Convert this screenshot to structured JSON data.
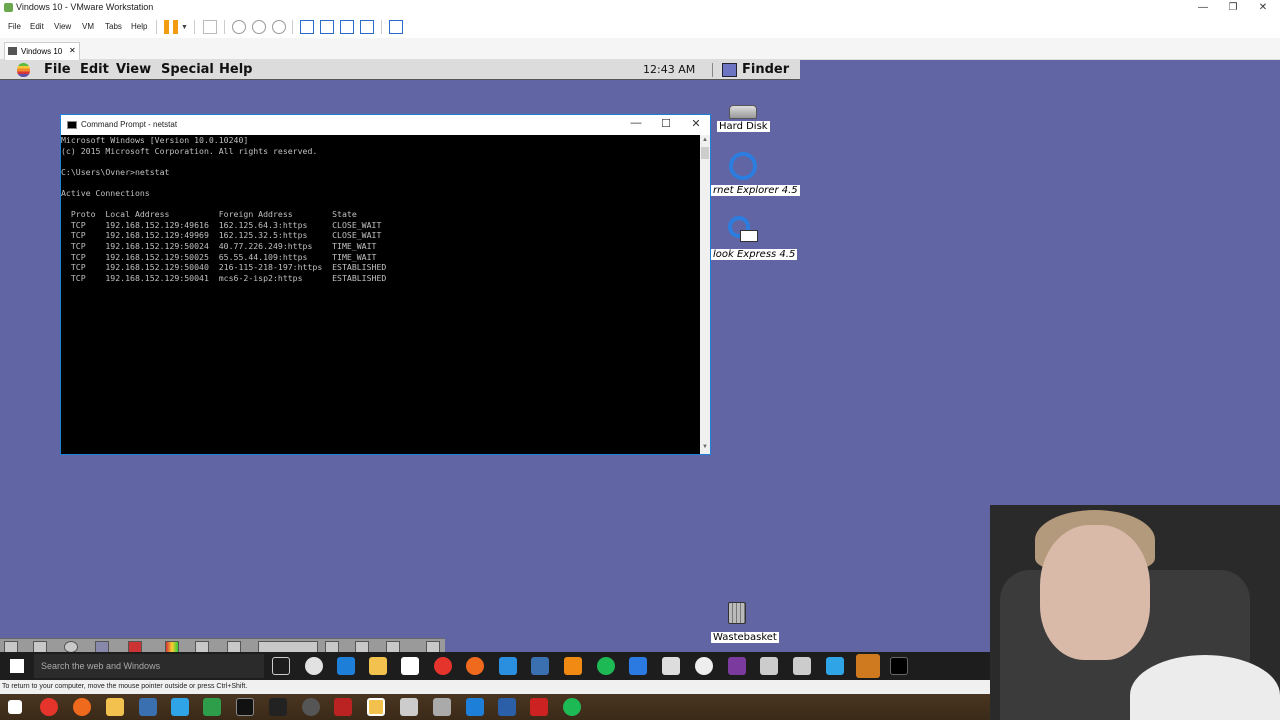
{
  "host": {
    "title": "Vindows 10 - VMware Workstation",
    "menu": [
      "File",
      "Edit",
      "View",
      "VM",
      "Tabs",
      "Help"
    ],
    "tab_label": "Vindows 10",
    "status_text": "To return to your computer, move the mouse pointer outside or press Ctrl+Shift."
  },
  "mac_menubar": {
    "items": [
      "File",
      "Edit",
      "View",
      "Special",
      "Help"
    ],
    "clock": "12:43 AM",
    "finder": "Finder"
  },
  "cmd": {
    "title": "Command Prompt - netstat",
    "output": "Microsoft Windows [Version 10.0.10240]\n(c) 2015 Microsoft Corporation. All rights reserved.\n\nC:\\Users\\Ovner>netstat\n\nActive Connections\n\n  Proto  Local Address          Foreign Address        State\n  TCP    192.168.152.129:49616  162.125.64.3:https     CLOSE_WAIT\n  TCP    192.168.152.129:49969  162.125.32.5:https     CLOSE_WAIT\n  TCP    192.168.152.129:50024  40.77.226.249:https    TIME_WAIT\n  TCP    192.168.152.129:50025  65.55.44.109:https     TIME_WAIT\n  TCP    192.168.152.129:50040  216-115-218-197:https  ESTABLISHED\n  TCP    192.168.152.129:50041  mcs6-2-isp2:https      ESTABLISHED"
  },
  "desktop_icons": {
    "hard_disk": "Hard Disk",
    "ie": "rnet Explorer 4.5",
    "oe": "look Express 4.5",
    "trash": "Wastebasket"
  },
  "guest_taskbar": {
    "search_placeholder": "Search the web and Windows"
  },
  "colors": {
    "desktop": "#6265a4",
    "cmd_bg": "#000000",
    "cmd_text": "#c0c0c0"
  }
}
